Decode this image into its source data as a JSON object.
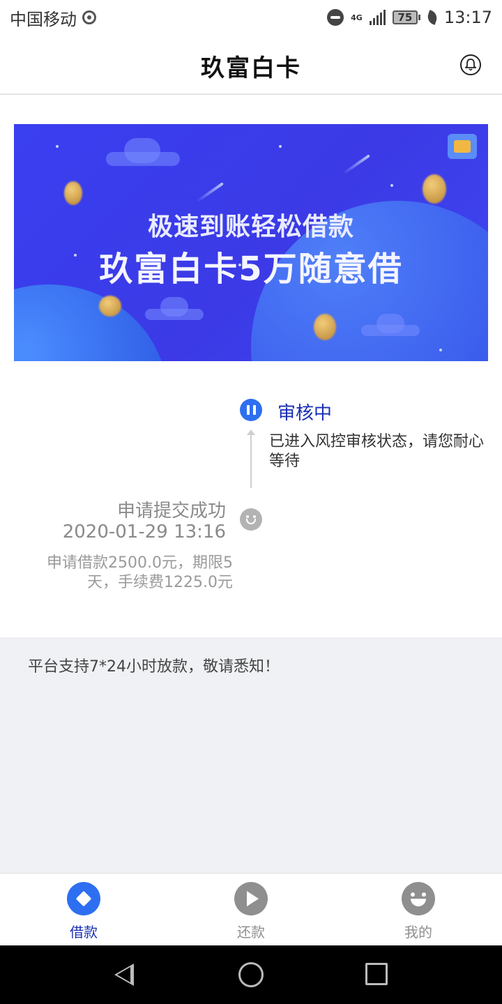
{
  "status_bar": {
    "carrier": "中国移动",
    "network": "4G",
    "battery": "75",
    "time": "13:17"
  },
  "header": {
    "title": "玖富白卡",
    "right_icon": "bell-icon"
  },
  "banner": {
    "line1": "极速到账轻松借款",
    "line2": "玖富白卡5万随意借"
  },
  "timeline": {
    "current": {
      "status": "审核中",
      "description": "已进入风控审核状态，请您耐心等待",
      "icon": "pause-circle-icon",
      "color": "#2d6ff0"
    },
    "previous": {
      "title": "申请提交成功",
      "time": "2020-01-29 13:16",
      "note": "申请借款2500.0元，期限5天，手续费1225.0元",
      "icon": "smile-icon"
    }
  },
  "notice": {
    "text": "平台支持7*24小时放款，敬请悉知！"
  },
  "bottom_nav": {
    "items": [
      {
        "label": "借款",
        "icon": "diamond-icon",
        "active": true
      },
      {
        "label": "还款",
        "icon": "play-icon",
        "active": false
      },
      {
        "label": "我的",
        "icon": "smiley-icon",
        "active": false
      }
    ]
  },
  "colors": {
    "accent": "#2d6ff0",
    "accent_text": "#1a2fb4",
    "banner_bg": "#3b3ae6",
    "notice_bg": "#eff1f4"
  }
}
